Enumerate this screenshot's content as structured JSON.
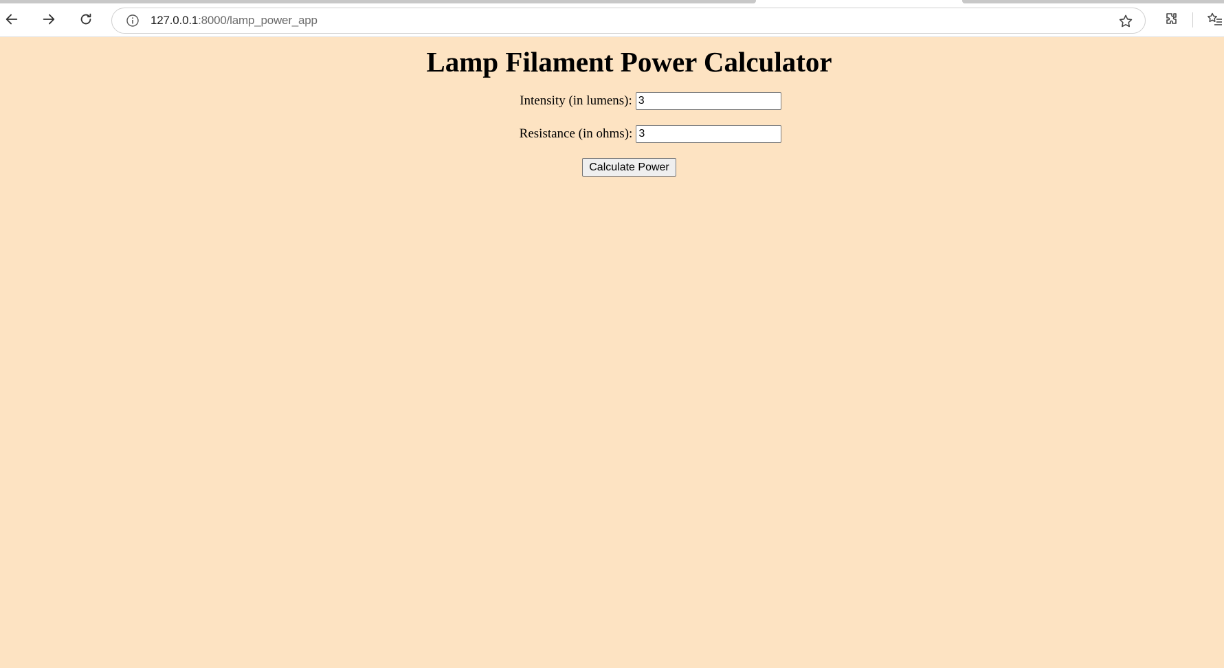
{
  "browser": {
    "url_host": "127.0.0.1",
    "url_rest": ":8000/lamp_power_app"
  },
  "page": {
    "title": "Lamp Filament Power Calculator",
    "intensity_label": "Intensity (in lumens):",
    "intensity_value": "3",
    "resistance_label": "Resistance (in ohms):",
    "resistance_value": "3",
    "calculate_button": "Calculate Power"
  },
  "colors": {
    "page_background": "#fde3c2"
  }
}
